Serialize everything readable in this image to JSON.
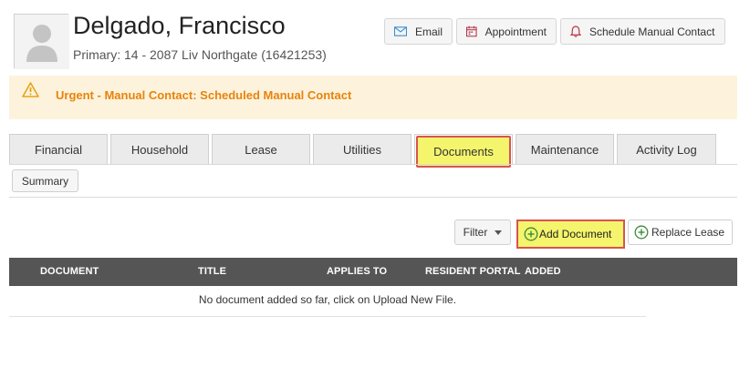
{
  "resident": {
    "name": "Delgado, Francisco",
    "primary": "Primary: 14 - 2087 Liv Northgate (16421253)"
  },
  "actions": {
    "email_label": "Email",
    "appointment_label": "Appointment",
    "schedule_label": "Schedule Manual Contact"
  },
  "alert": {
    "text": "Urgent - Manual Contact: Scheduled Manual Contact",
    "color": "#e8830c"
  },
  "tabs": [
    {
      "label": "Financial"
    },
    {
      "label": "Household"
    },
    {
      "label": "Lease"
    },
    {
      "label": "Utilities"
    },
    {
      "label": "Documents"
    },
    {
      "label": "Maintenance"
    },
    {
      "label": "Activity Log"
    }
  ],
  "active_tab": "Documents",
  "subtabs": {
    "summary_label": "Summary"
  },
  "toolbar": {
    "filter_label": "Filter",
    "add_document_label": "Add Document",
    "replace_lease_label": "Replace Lease"
  },
  "table": {
    "columns": [
      "DOCUMENT",
      "TITLE",
      "APPLIES TO",
      "RESIDENT PORTAL",
      "ADDED"
    ],
    "empty_message": "No document added so far, click on Upload New File."
  },
  "icons": {
    "avatar": "person-silhouette-icon",
    "email": "envelope-icon",
    "appointment": "calendar-icon",
    "schedule": "bell-icon",
    "alert": "warning-triangle-icon",
    "add": "plus-circle-icon"
  },
  "colors": {
    "highlight": "#f4f56c",
    "highlight_border": "#d9534f",
    "table_header": "#555555"
  }
}
